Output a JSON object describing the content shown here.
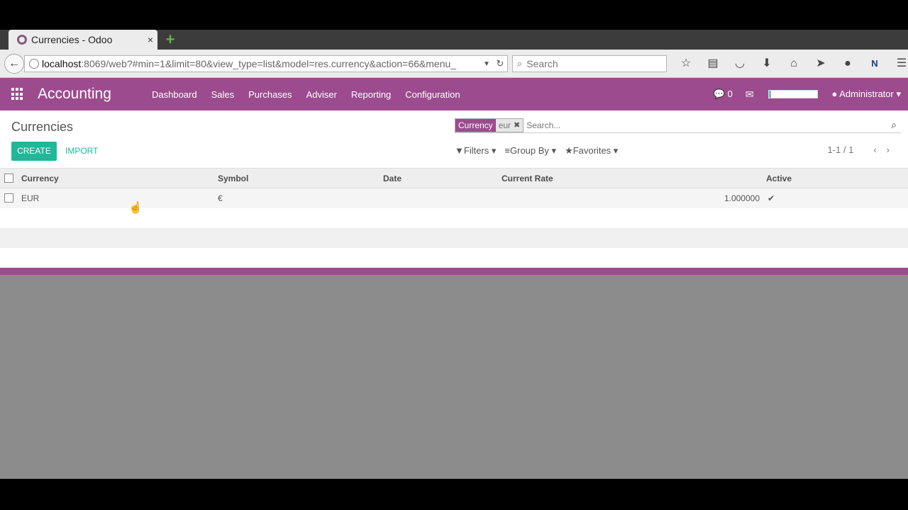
{
  "browser": {
    "tab_title": "Currencies - Odoo",
    "tab_close": "×",
    "new_tab": "+",
    "url_host": "localhost",
    "url_path": ":8069/web?#min=1&limit=80&view_type=list&model=res.currency&action=66&menu_",
    "search_placeholder": "Search"
  },
  "odoo": {
    "app_title": "Accounting",
    "menu": [
      "Dashboard",
      "Sales",
      "Purchases",
      "Adviser",
      "Reporting",
      "Configuration"
    ],
    "chat_count": "0",
    "user": "Administrator",
    "progress_fraction": 0.05,
    "accent_color": "#9c4b8e",
    "button_color": "#21b799"
  },
  "panel": {
    "breadcrumb": "Currencies",
    "facet_label": "Currency",
    "facet_value": "eur",
    "search_placeholder": "Search...",
    "create_label": "CREATE",
    "import_label": "IMPORT",
    "filters_label": "Filters",
    "groupby_label": "Group By",
    "favorites_label": "Favorites",
    "pager_value": "1-1 / 1"
  },
  "list": {
    "columns": [
      "Currency",
      "Symbol",
      "Date",
      "Current Rate",
      "Active"
    ],
    "rows": [
      {
        "currency": "EUR",
        "symbol": "€",
        "date": "",
        "rate": "1.000000",
        "active": "✔"
      }
    ]
  }
}
